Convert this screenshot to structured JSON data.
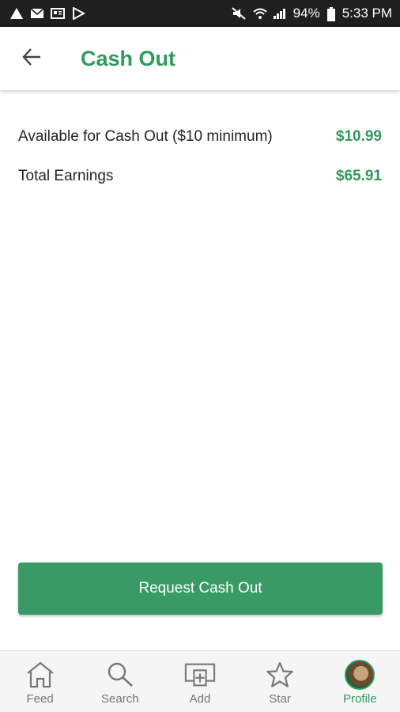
{
  "status_bar": {
    "battery": "94%",
    "time": "5:33 PM"
  },
  "app_bar": {
    "title": "Cash Out"
  },
  "summary": {
    "rows": [
      {
        "label": "Available for Cash Out ($10 minimum)",
        "value": "$10.99"
      },
      {
        "label": "Total Earnings",
        "value": "$65.91"
      }
    ]
  },
  "action": {
    "label": "Request Cash Out"
  },
  "bottom_nav": {
    "items": [
      {
        "label": "Feed",
        "icon": "home-icon"
      },
      {
        "label": "Search",
        "icon": "search-icon"
      },
      {
        "label": "Add",
        "icon": "add-icon"
      },
      {
        "label": "Star",
        "icon": "star-icon"
      },
      {
        "label": "Profile",
        "icon": "avatar"
      }
    ],
    "active": "Profile"
  },
  "colors": {
    "accent": "#2f9a5c",
    "button": "#3a9a66",
    "status_bar": "#1f1f1f"
  }
}
